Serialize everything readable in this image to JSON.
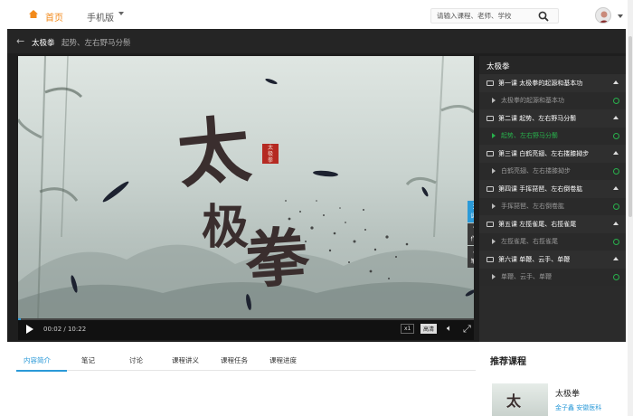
{
  "nav": {
    "home": "首页",
    "mobile": "手机版",
    "search_placeholder": "请输入课程、老师、学校"
  },
  "breadcrumb": {
    "course": "太极拳",
    "lesson": "起势、左右野马分鬃"
  },
  "video": {
    "title_chars": [
      "太",
      "极",
      "拳"
    ],
    "seal_text": "太极拳",
    "time": "00:02 / 10:22",
    "progress": 0.003,
    "speed": "x1",
    "quality": "高清",
    "side_tools": [
      {
        "label": "课节",
        "icon": "list-icon"
      },
      {
        "label": "作业",
        "icon": "edit-icon",
        "badge": "1"
      },
      {
        "label": "笔记",
        "icon": "pencil-icon"
      }
    ]
  },
  "playlist": {
    "title": "太极拳",
    "items": [
      {
        "type": "chapter",
        "label": "第一课 太极拳的起源和基本功"
      },
      {
        "type": "lesson",
        "label": "太极拳的起源和基本功",
        "active": false
      },
      {
        "type": "chapter",
        "label": "第二课 起势、左右野马分鬃"
      },
      {
        "type": "lesson",
        "label": "起势、左右野马分鬃",
        "active": true
      },
      {
        "type": "chapter",
        "label": "第三课 白鹤亮翅、左右搂膝拗步"
      },
      {
        "type": "lesson",
        "label": "白鹤亮翅、左右搂膝拗步",
        "active": false
      },
      {
        "type": "chapter",
        "label": "第四课 手挥琵琶、左右倒卷肱"
      },
      {
        "type": "lesson",
        "label": "手挥琵琶、左右倒卷肱",
        "active": false
      },
      {
        "type": "chapter",
        "label": "第五课 左揽雀尾、右揽雀尾"
      },
      {
        "type": "lesson",
        "label": "左揽雀尾、右揽雀尾",
        "active": false
      },
      {
        "type": "chapter",
        "label": "第六课 单鞭、云手、单鞭"
      },
      {
        "type": "lesson",
        "label": "单鞭、云手、单鞭",
        "active": false
      }
    ]
  },
  "tabs": [
    "内容简介",
    "笔记",
    "讨论",
    "课程讲义",
    "课程任务",
    "课程进度"
  ],
  "recommend": {
    "title": "推荐课程",
    "thumb_char": "太",
    "name": "太极拳",
    "meta": "金子鑫  安徽医科"
  },
  "colors": {
    "accent": "#2b9ad8",
    "active_green": "#28b14c",
    "home_orange": "#f28a1b"
  }
}
